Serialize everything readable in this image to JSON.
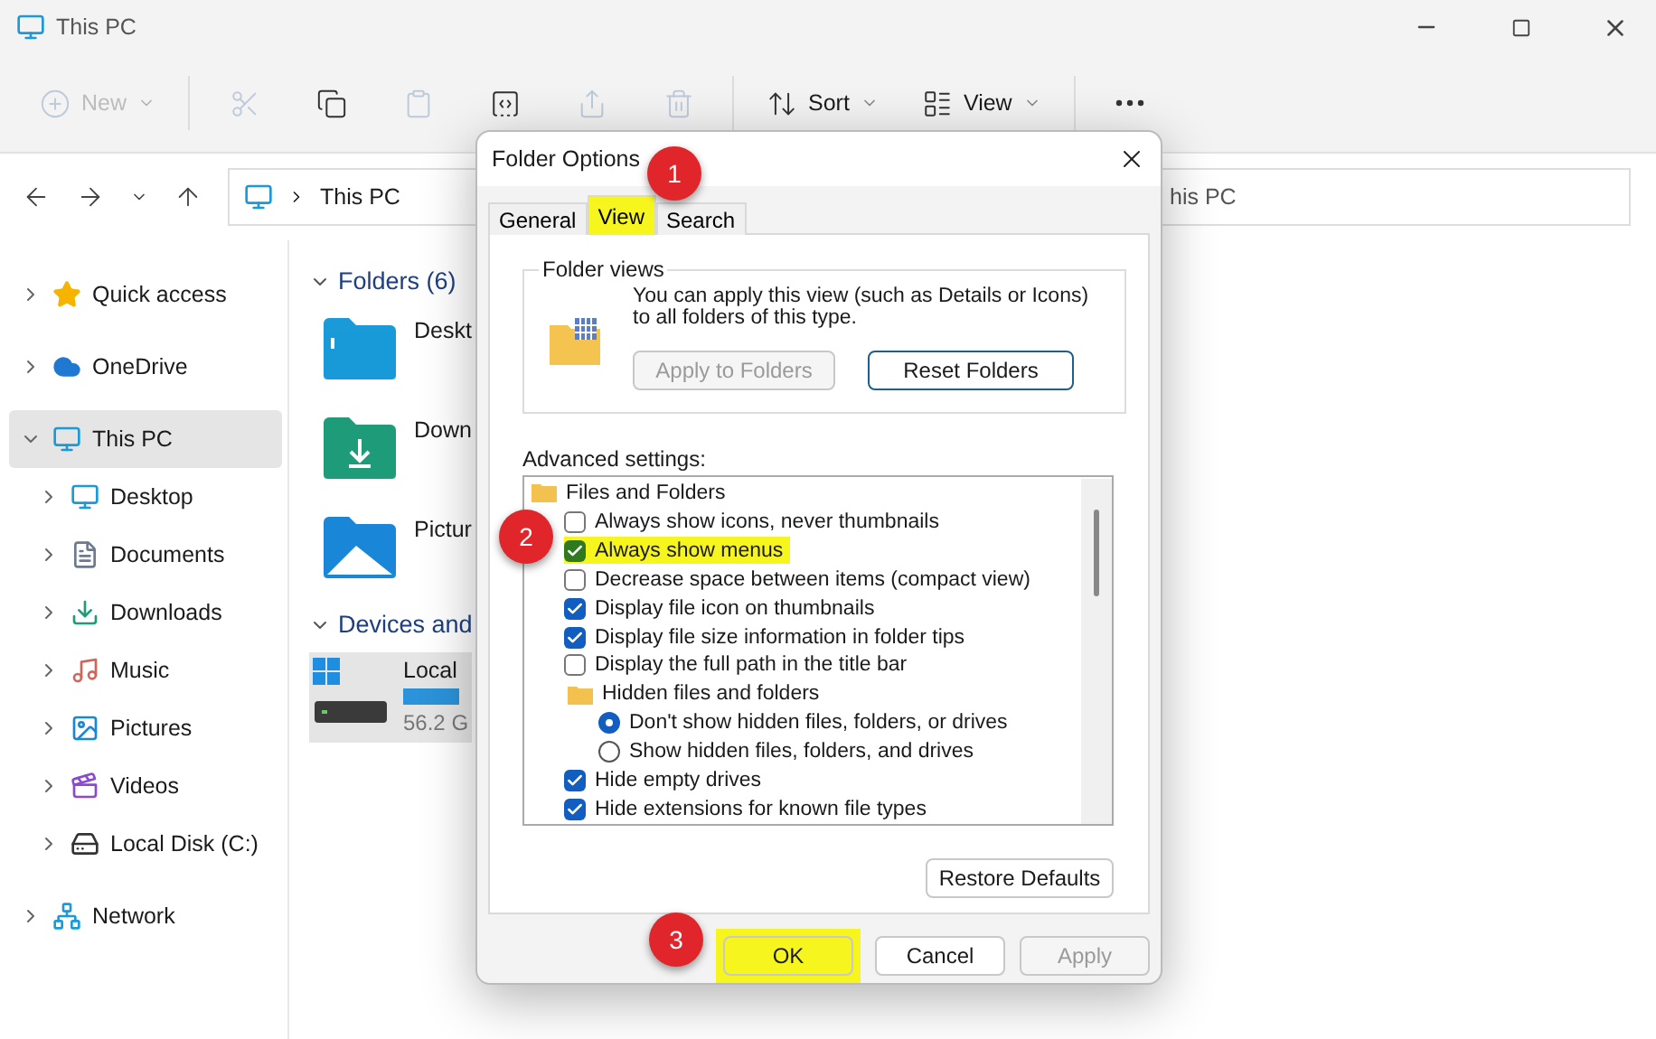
{
  "window": {
    "title": "This PC"
  },
  "toolbar": {
    "items": [
      {
        "kind": "menu",
        "label": "New",
        "disabled": true
      },
      {
        "kind": "icon",
        "disabled": true
      },
      {
        "kind": "icon",
        "disabled": false
      },
      {
        "kind": "icon",
        "disabled": true
      },
      {
        "kind": "icon",
        "disabled": false
      },
      {
        "kind": "icon",
        "disabled": true
      },
      {
        "kind": "icon",
        "disabled": true
      },
      {
        "kind": "menu",
        "label": "Sort",
        "disabled": false
      },
      {
        "kind": "menu",
        "label": "View",
        "disabled": false
      },
      {
        "kind": "icon",
        "disabled": false
      }
    ]
  },
  "address": {
    "segments": [
      "This PC"
    ]
  },
  "search": {
    "placeholder": "his PC"
  },
  "sidebar": {
    "items": [
      {
        "label": "Quick access",
        "expanded": false,
        "selected": false
      },
      {
        "label": "OneDrive",
        "expanded": false,
        "selected": false
      },
      {
        "label": "This PC",
        "expanded": true,
        "selected": true,
        "children": [
          {
            "label": "Desktop",
            "expanded": false,
            "selected": false
          },
          {
            "label": "Documents",
            "expanded": false,
            "selected": false
          },
          {
            "label": "Downloads",
            "expanded": false,
            "selected": false
          },
          {
            "label": "Music",
            "expanded": false,
            "selected": false
          },
          {
            "label": "Pictures",
            "expanded": false,
            "selected": false
          },
          {
            "label": "Videos",
            "expanded": false,
            "selected": false
          },
          {
            "label": "Local Disk (C:)",
            "expanded": false,
            "selected": false
          }
        ]
      },
      {
        "label": "Network",
        "expanded": false,
        "selected": false
      }
    ]
  },
  "content": {
    "groups": [
      {
        "title": "Folders (6)",
        "expanded": true,
        "items": [
          {
            "kind": "folder",
            "label": "Deskt",
            "selected": false
          },
          {
            "kind": "folder",
            "label": "Down",
            "selected": false
          },
          {
            "kind": "folder",
            "label": "Pictur",
            "selected": false
          }
        ]
      },
      {
        "title": "Devices and",
        "expanded": true,
        "items": [
          {
            "kind": "drive",
            "label": "Local",
            "detail": "56.2 G",
            "selected": true
          }
        ]
      }
    ]
  },
  "dialog": {
    "title": "Folder Options",
    "tabs": [
      {
        "label": "General",
        "selected": false,
        "highlighted": false
      },
      {
        "label": "View",
        "selected": true,
        "highlighted": true
      },
      {
        "label": "Search",
        "selected": false,
        "highlighted": false
      }
    ],
    "folder_views": {
      "title": "Folder views",
      "description": "You can apply this view (such as Details or Icons) to all folders of this type.",
      "buttons": [
        {
          "label": "Apply to Folders",
          "disabled": true
        },
        {
          "label": "Reset Folders",
          "disabled": false
        }
      ]
    },
    "advanced": {
      "label": "Advanced settings:",
      "items": [
        {
          "kind": "folder",
          "label": "Files and Folders",
          "children": [
            {
              "kind": "checkbox",
              "label": "Always show icons, never thumbnails",
              "checked": false,
              "highlighted": false
            },
            {
              "kind": "checkbox",
              "label": "Always show menus",
              "checked": true,
              "highlighted": true
            },
            {
              "kind": "checkbox",
              "label": "Decrease space between items (compact view)",
              "checked": false,
              "highlighted": false
            },
            {
              "kind": "checkbox",
              "label": "Display file icon on thumbnails",
              "checked": true,
              "highlighted": false
            },
            {
              "kind": "checkbox",
              "label": "Display file size information in folder tips",
              "checked": true,
              "highlighted": false
            },
            {
              "kind": "checkbox",
              "label": "Display the full path in the title bar",
              "checked": false,
              "highlighted": false
            },
            {
              "kind": "folder",
              "label": "Hidden files and folders",
              "children": [
                {
                  "kind": "radio",
                  "label": "Don't show hidden files, folders, or drives",
                  "selected": true
                },
                {
                  "kind": "radio",
                  "label": "Show hidden files, folders, and drives",
                  "selected": false
                }
              ]
            },
            {
              "kind": "checkbox",
              "label": "Hide empty drives",
              "checked": true,
              "highlighted": false
            },
            {
              "kind": "checkbox",
              "label": "Hide extensions for known file types",
              "checked": true,
              "highlighted": false
            }
          ]
        }
      ]
    },
    "restore_button": {
      "label": "Restore Defaults"
    },
    "buttons": [
      {
        "label": "OK",
        "disabled": false,
        "highlighted": true
      },
      {
        "label": "Cancel",
        "disabled": false,
        "highlighted": false
      },
      {
        "label": "Apply",
        "disabled": true,
        "highlighted": false
      }
    ],
    "annotations": [
      {
        "label": "1"
      },
      {
        "label": "2"
      },
      {
        "label": "3"
      }
    ]
  }
}
